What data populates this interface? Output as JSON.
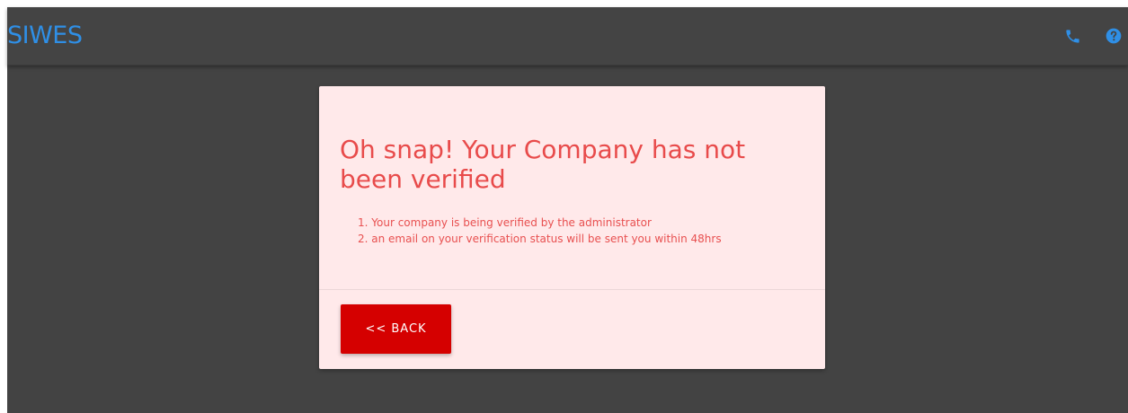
{
  "app": {
    "title": "SIWES",
    "brand_color": "#2f8fe6",
    "actions": [
      {
        "icon": "phone-icon"
      },
      {
        "icon": "help-icon"
      }
    ]
  },
  "alert": {
    "title": "Oh snap! Your Company has not been verified",
    "reasons": [
      "1. Your company is being verified by the administrator",
      "2. an email on your verification status will be sent you within 48hrs"
    ],
    "back_label": "<< BACK",
    "background_color": "#ffe9ea",
    "text_color": "#e84b4b",
    "button_color": "#d50000"
  }
}
